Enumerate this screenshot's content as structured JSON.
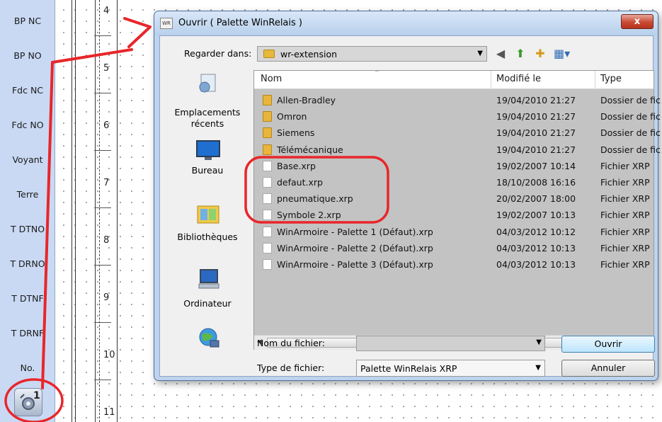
{
  "palette": {
    "items": [
      "BP NC",
      "BP NO",
      "Fdc NC",
      "Fdc NO",
      "Voyant",
      "Terre",
      "T DTNO",
      "T DRNO",
      "T DTNF",
      "T DRNF",
      "No."
    ],
    "tool_number": "1"
  },
  "ruler": {
    "numbers": [
      "4",
      "5",
      "6",
      "7",
      "8",
      "9",
      "10",
      "11"
    ]
  },
  "dialog": {
    "title": "Ouvrir ( Palette WinRelais )",
    "close_label": "x",
    "look_in_label": "Regarder dans:",
    "look_in_value": "wr-extension",
    "places": [
      {
        "label": "Emplacements récents",
        "icon": "recent-places-icon"
      },
      {
        "label": "Bureau",
        "icon": "desktop-icon"
      },
      {
        "label": "Bibliothèques",
        "icon": "libraries-icon"
      },
      {
        "label": "Ordinateur",
        "icon": "computer-icon"
      },
      {
        "label": "",
        "icon": "network-icon"
      }
    ],
    "columns": {
      "name": "Nom",
      "modified": "Modifié le",
      "type": "Type"
    },
    "files": [
      {
        "name": "Allen-Bradley",
        "modified": "19/04/2010 21:27",
        "type": "Dossier de fic",
        "kind": "folder"
      },
      {
        "name": "Omron",
        "modified": "19/04/2010 21:27",
        "type": "Dossier de fic",
        "kind": "folder"
      },
      {
        "name": "Siemens",
        "modified": "19/04/2010 21:27",
        "type": "Dossier de fic",
        "kind": "folder"
      },
      {
        "name": "Télémécanique",
        "modified": "19/04/2010 21:27",
        "type": "Dossier de fic",
        "kind": "folder"
      },
      {
        "name": "Base.xrp",
        "modified": "19/02/2007 10:14",
        "type": "Fichier XRP",
        "kind": "file"
      },
      {
        "name": "defaut.xrp",
        "modified": "18/10/2008 16:16",
        "type": "Fichier XRP",
        "kind": "file"
      },
      {
        "name": "pneumatique.xrp",
        "modified": "20/02/2007 18:00",
        "type": "Fichier XRP",
        "kind": "file"
      },
      {
        "name": "Symbole 2.xrp",
        "modified": "19/02/2007 10:13",
        "type": "Fichier XRP",
        "kind": "file"
      },
      {
        "name": "WinArmoire - Palette 1 (Défaut).xrp",
        "modified": "04/03/2012 10:12",
        "type": "Fichier XRP",
        "kind": "file"
      },
      {
        "name": "WinArmoire - Palette 2 (Défaut).xrp",
        "modified": "04/03/2012 10:13",
        "type": "Fichier XRP",
        "kind": "file"
      },
      {
        "name": "WinArmoire - Palette 3 (Défaut).xrp",
        "modified": "04/03/2012 10:13",
        "type": "Fichier XRP",
        "kind": "file"
      }
    ],
    "filename_label": "Nom du fichier:",
    "filename_value": "",
    "filetype_label": "Type de fichier:",
    "filetype_value": "Palette WinRelais XRP",
    "open_label": "Ouvrir",
    "cancel_label": "Annuler",
    "scroll_grip": "III"
  },
  "colors": {
    "annotation": "#e8262a",
    "close_button": "#c84a34",
    "folder": "#e9b53a"
  }
}
